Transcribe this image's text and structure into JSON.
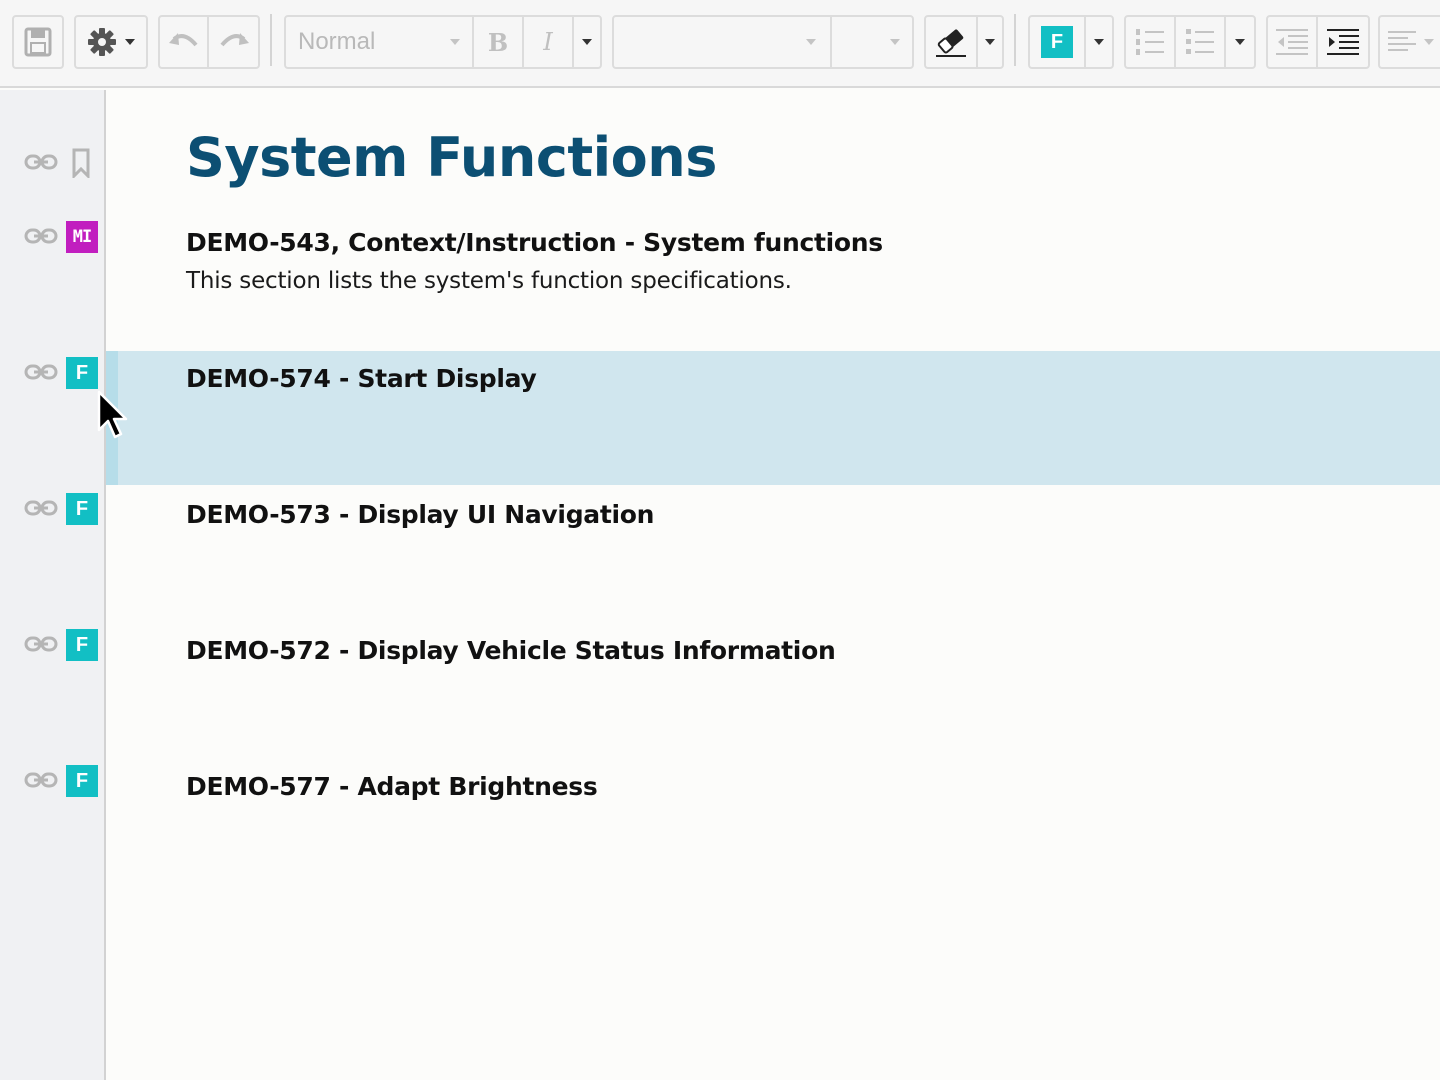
{
  "toolbar": {
    "paragraph_style": "Normal",
    "bold_label": "B",
    "italic_label": "I",
    "font_family": "",
    "font_size": "",
    "insert_item_badge": "F"
  },
  "document": {
    "title": "System Functions",
    "rows": [
      {
        "badge": "MI",
        "badge_color": "#c11ebf",
        "heading": "DEMO-543, Context/Instruction - System functions",
        "text": "This section lists the system's function specifications."
      },
      {
        "badge": "F",
        "badge_color": "#12bfc4",
        "heading": "DEMO-574 - Start Display",
        "selected": true
      },
      {
        "badge": "F",
        "badge_color": "#12bfc4",
        "heading": "DEMO-573 - Display UI Navigation"
      },
      {
        "badge": "F",
        "badge_color": "#12bfc4",
        "heading": "DEMO-572 - Display Vehicle Status Information"
      },
      {
        "badge": "F",
        "badge_color": "#12bfc4",
        "heading": "DEMO-577 - Adapt Brightness"
      }
    ]
  },
  "colors": {
    "title": "#0c4f73",
    "selection": "#d0e6ee",
    "function_badge": "#12bfc4",
    "instruction_badge": "#c11ebf"
  }
}
